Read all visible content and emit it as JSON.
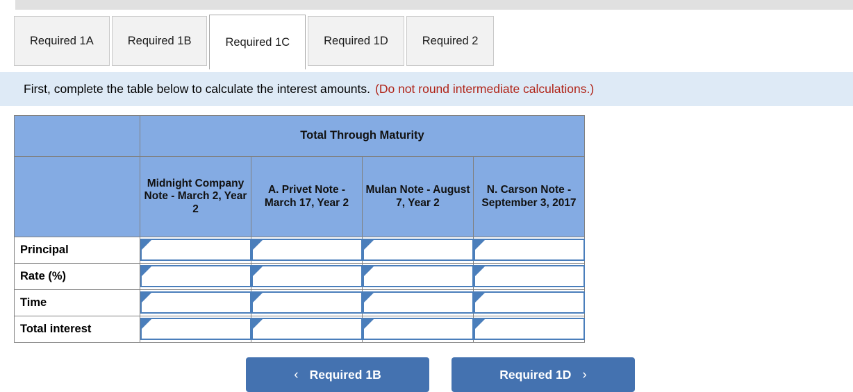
{
  "tabs": [
    {
      "label": "Required 1A",
      "active": false
    },
    {
      "label": "Required 1B",
      "active": false
    },
    {
      "label": "Required 1C",
      "active": true
    },
    {
      "label": "Required 1D",
      "active": false
    },
    {
      "label": "Required 2",
      "active": false
    }
  ],
  "instruction": {
    "main": "First, complete the table below to calculate the interest amounts.",
    "note": "(Do not round intermediate calculations.)"
  },
  "table": {
    "merged_header": "Total Through Maturity",
    "columns": [
      "Midnight Company Note - March 2, Year 2",
      "A. Privet Note - March 17, Year 2",
      "Mulan Note - August 7, Year 2",
      "N. Carson Note - September 3, 2017"
    ],
    "rows": [
      {
        "label": "Principal",
        "values": [
          "",
          "",
          "",
          ""
        ]
      },
      {
        "label": "Rate (%)",
        "values": [
          "",
          "",
          "",
          ""
        ]
      },
      {
        "label": "Time",
        "values": [
          "",
          "",
          "",
          ""
        ]
      },
      {
        "label": "Total interest",
        "values": [
          "",
          "",
          "",
          ""
        ]
      }
    ]
  },
  "nav": {
    "prev_label": "Required 1B",
    "next_label": "Required 1D",
    "prev_chevron": "‹",
    "next_chevron": "›"
  },
  "colors": {
    "header_blue": "#84abe3",
    "button_blue": "#4472b0",
    "instruction_bg": "#deeaf6",
    "note_red": "#b02418",
    "input_border": "#4a7ebb"
  }
}
